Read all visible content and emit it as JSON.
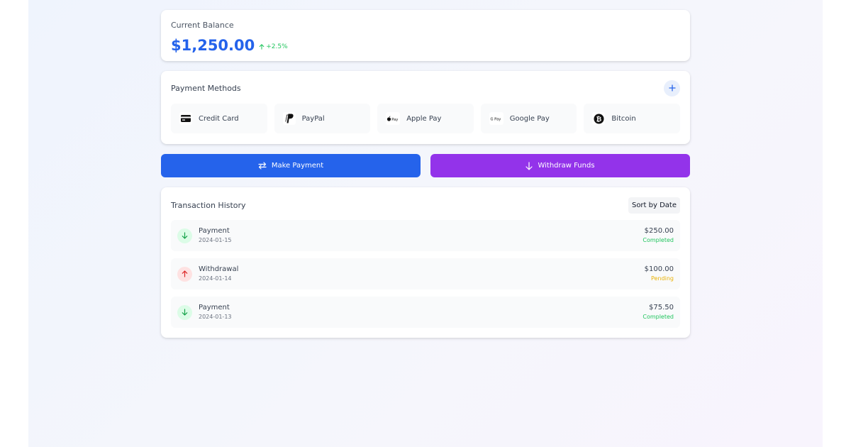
{
  "balance": {
    "label": "Current Balance",
    "amount": "$1,250.00",
    "change": "+2.5%"
  },
  "payment_methods": {
    "title": "Payment Methods",
    "add_icon": "plus-icon",
    "items": [
      {
        "label": "Credit Card",
        "icon": "credit-card-icon"
      },
      {
        "label": "PayPal",
        "icon": "paypal-icon"
      },
      {
        "label": "Apple Pay",
        "icon": "apple-pay-icon",
        "icon_text": "Pay"
      },
      {
        "label": "Google Pay",
        "icon": "google-pay-icon",
        "icon_text": "G Pay"
      },
      {
        "label": "Bitcoin",
        "icon": "bitcoin-icon"
      }
    ]
  },
  "actions": {
    "make_payment": "Make Payment",
    "withdraw_funds": "Withdraw Funds"
  },
  "transactions": {
    "title": "Transaction History",
    "sort_label": "Sort by Date",
    "items": [
      {
        "type": "Payment",
        "date": "2024-01-15",
        "amount": "$250.00",
        "status": "Completed"
      },
      {
        "type": "Withdrawal",
        "date": "2024-01-14",
        "amount": "$100.00",
        "status": "Pending"
      },
      {
        "type": "Payment",
        "date": "2024-01-13",
        "amount": "$75.50",
        "status": "Completed"
      }
    ]
  },
  "colors": {
    "primary": "#2563eb",
    "withdraw": "#9333ea",
    "success": "#22c55e",
    "pending": "#eab308",
    "danger": "#ef4444"
  }
}
